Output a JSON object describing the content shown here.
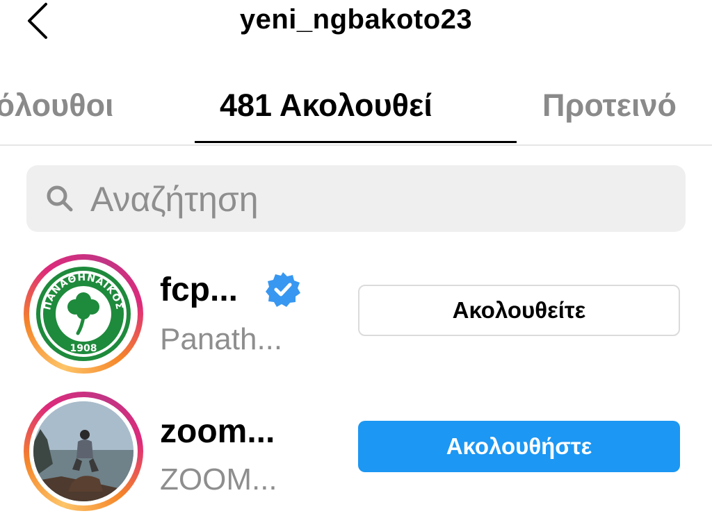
{
  "header": {
    "title": "yeni_ngbakoto23",
    "back_icon": "chevron-left-icon"
  },
  "tabs": [
    {
      "label": "κόλουθοι"
    },
    {
      "label": "481 Ακολουθεί"
    },
    {
      "label": "Προτεινό"
    }
  ],
  "search": {
    "placeholder": "Αναζήτηση",
    "icon": "search-icon"
  },
  "rows": [
    {
      "username": "fcp...",
      "fullname": "Panath...",
      "verified": true,
      "button_label": "Ακολουθείτε",
      "button_state": "following",
      "logo_text": "ΠΑΝΑΘΗΝΑΪΚΟΣ",
      "logo_year": "1908"
    },
    {
      "username": "zoom...",
      "fullname": "ZOOM...",
      "verified": false,
      "button_label": "Ακολουθήστε",
      "button_state": "follow"
    }
  ],
  "colors": {
    "follow_blue": "#1c97f3",
    "verified_blue": "#3897f0",
    "logo_green": "#1e8a3c"
  }
}
